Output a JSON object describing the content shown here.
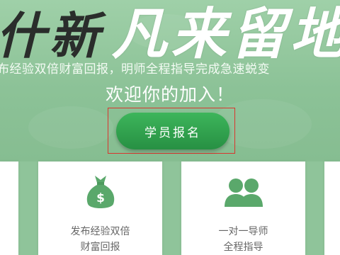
{
  "hero": {
    "calligraphy_dark": "什新",
    "calligraphy_light": "凡来留地",
    "tagline": "布经验双倍财富回报，明师全程指导完成急速蜕变",
    "welcome": "欢迎你的加入！",
    "join_button": "学员报名"
  },
  "cards": [
    {
      "icon": "money-bag-icon",
      "symbol": "$",
      "line1": "发布经验双倍",
      "line2": "财富回报"
    },
    {
      "icon": "users-icon",
      "line1": "一对一导师",
      "line2": "全程指导"
    }
  ],
  "colors": {
    "accent": "#2f9f4d",
    "hero_bg": "#8fc49a",
    "highlight": "#d9352e"
  }
}
